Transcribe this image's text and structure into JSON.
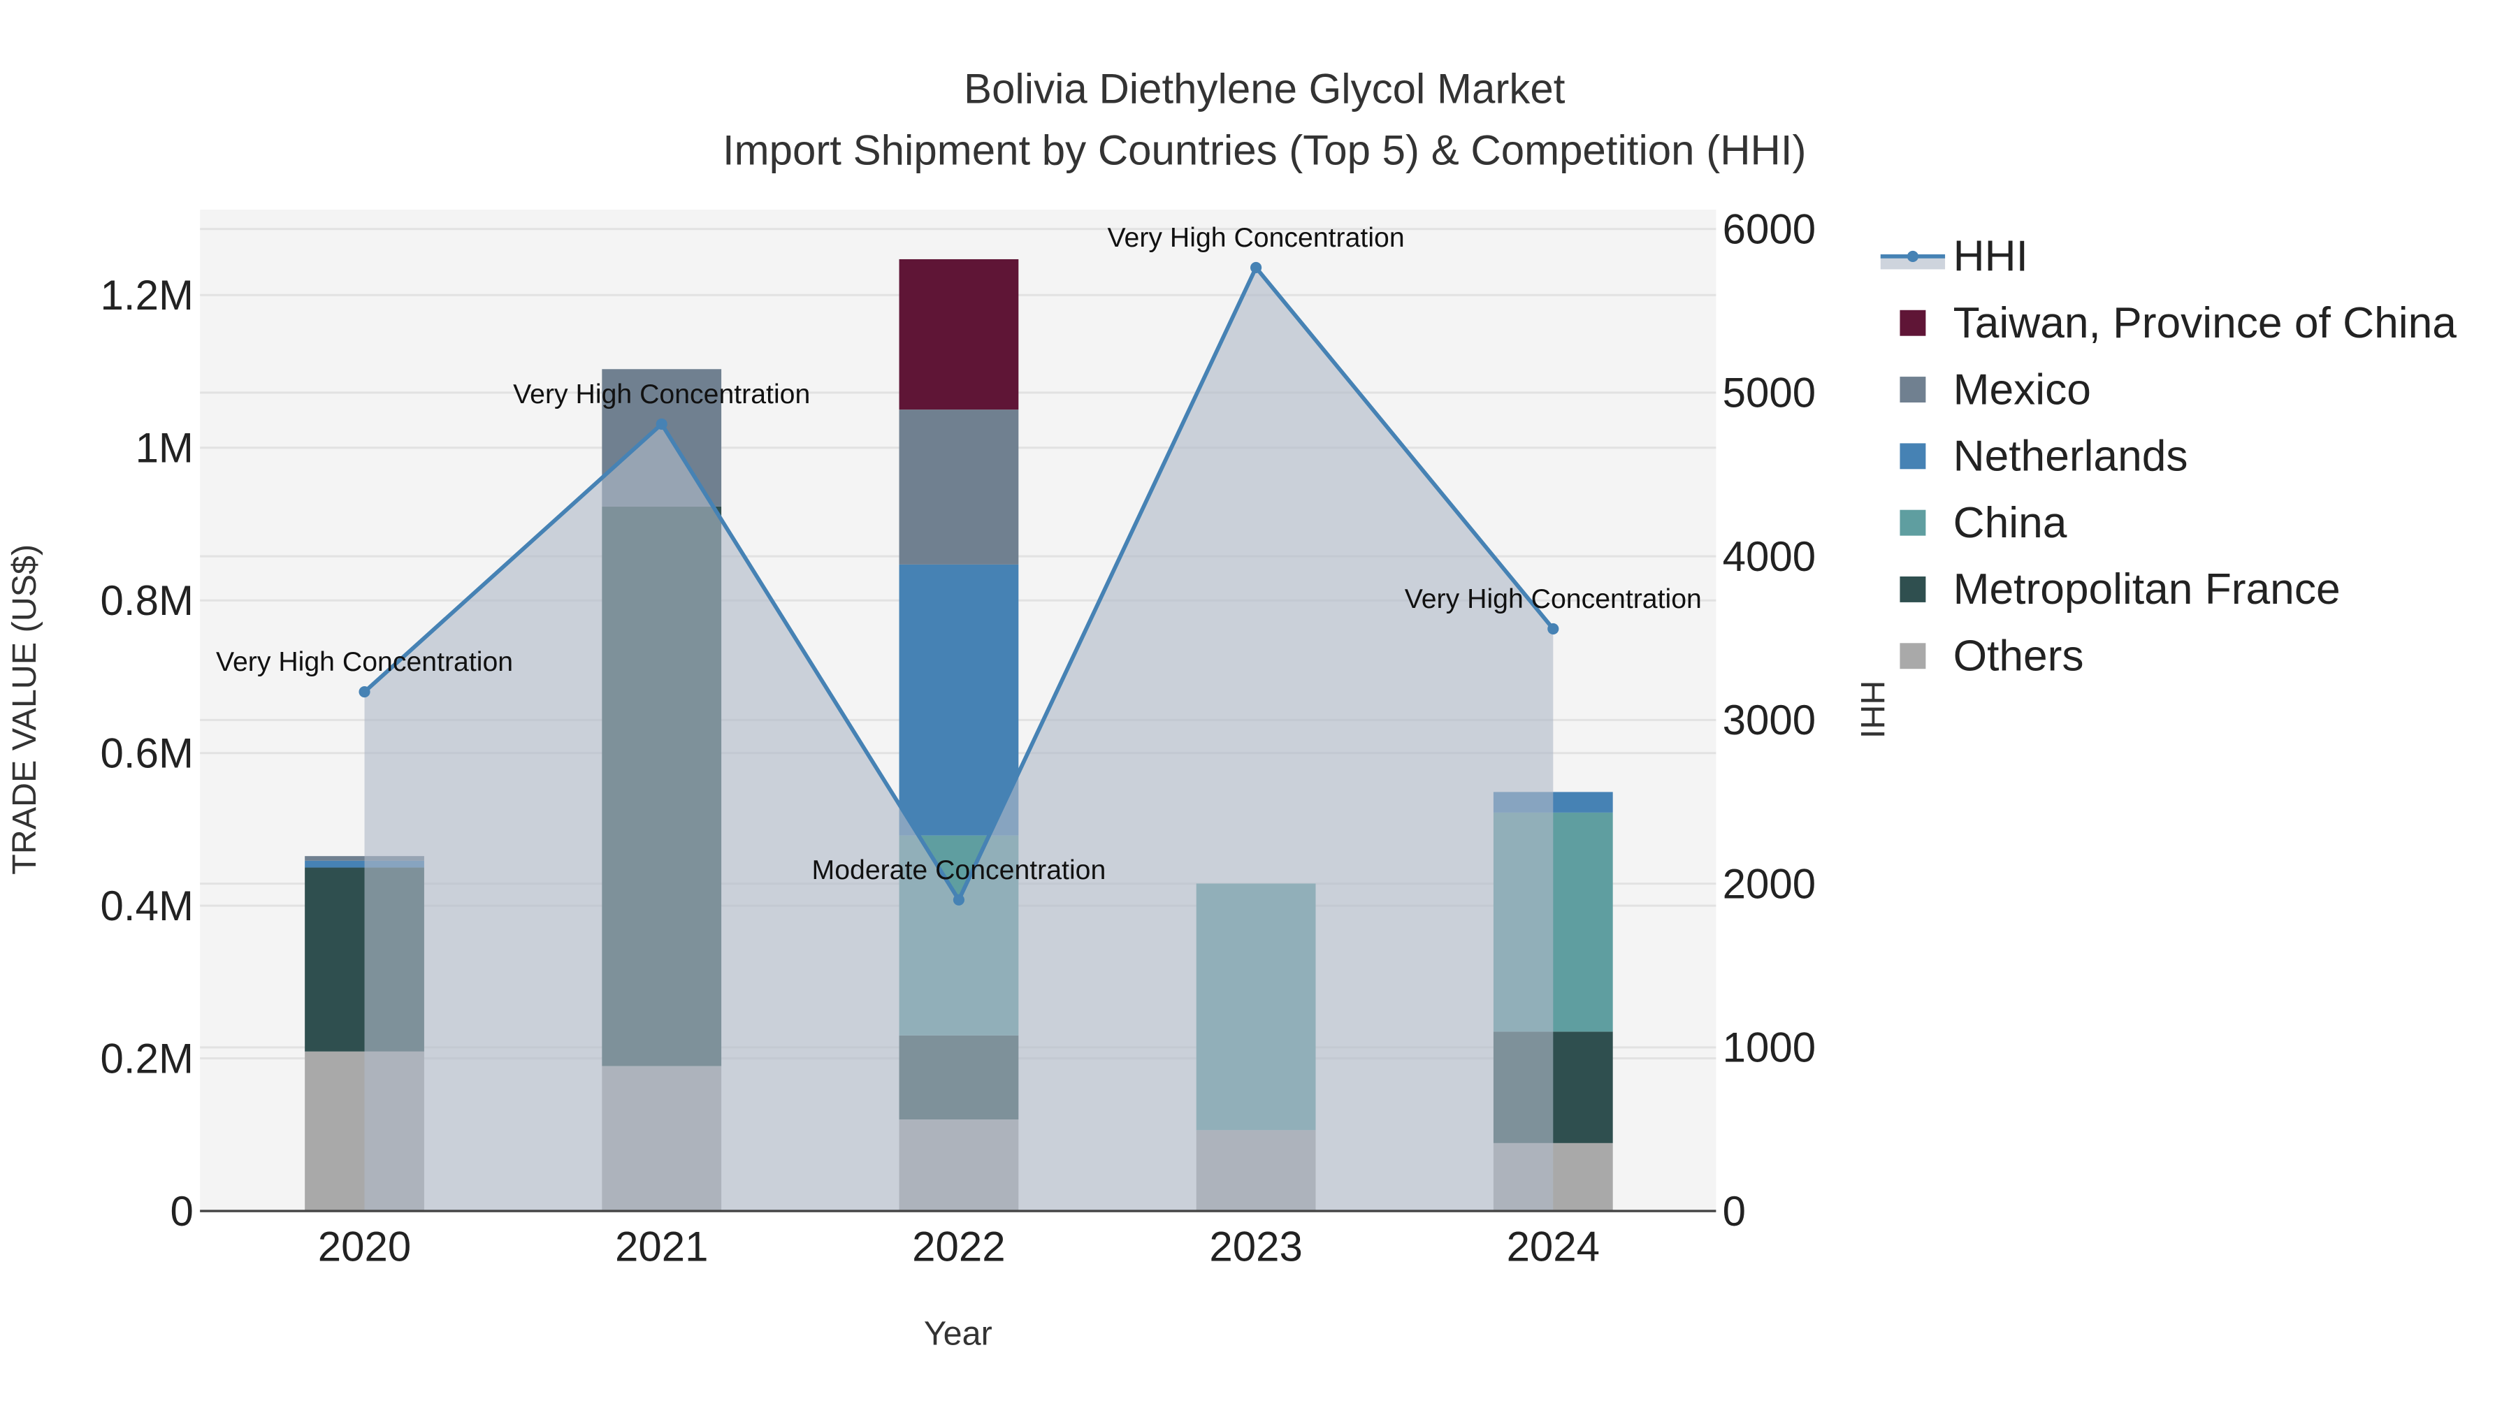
{
  "chart_data": {
    "type": "bar",
    "title": "Bolivia Diethylene Glycol Market",
    "subtitle": "Import Shipment by Countries (Top 5) & Competition (HHI)",
    "xlabel": "Year",
    "ylabel": "TRADE VALUE (US$)",
    "y2label": "HHI",
    "categories": [
      "2020",
      "2021",
      "2022",
      "2023",
      "2024"
    ],
    "ylim": [
      0,
      1300000
    ],
    "y2lim": [
      0,
      6120
    ],
    "yticks": [
      {
        "v": 0,
        "label": "0"
      },
      {
        "v": 200000,
        "label": "0.2M"
      },
      {
        "v": 400000,
        "label": "0.4M"
      },
      {
        "v": 600000,
        "label": "0.6M"
      },
      {
        "v": 800000,
        "label": "0.8M"
      },
      {
        "v": 1000000,
        "label": "1M"
      },
      {
        "v": 1200000,
        "label": "1.2M"
      }
    ],
    "y2ticks": [
      0,
      1000,
      2000,
      3000,
      4000,
      5000,
      6000
    ],
    "stacked": true,
    "series": [
      {
        "name": "Others",
        "color": "#a9a9a9",
        "values": [
          209000,
          190000,
          120000,
          106000,
          89000
        ]
      },
      {
        "name": "Metropolitan France",
        "color": "#2f4f4f",
        "values": [
          241000,
          733000,
          110000,
          0,
          146000
        ]
      },
      {
        "name": "China",
        "color": "#5f9ea0",
        "values": [
          0,
          0,
          262000,
          323000,
          287000
        ]
      },
      {
        "name": "Netherlands",
        "color": "#4682b4",
        "values": [
          9000,
          0,
          355000,
          0,
          27000
        ]
      },
      {
        "name": "Mexico",
        "color": "#708090",
        "values": [
          6000,
          180000,
          203000,
          0,
          0
        ]
      },
      {
        "name": "Taiwan, Province of China",
        "color": "#5f1536",
        "values": [
          0,
          0,
          197000,
          0,
          0
        ]
      }
    ],
    "hhi": {
      "name": "HHI",
      "color": "#4682b4",
      "values": [
        3172,
        4808,
        1901,
        5764,
        3557
      ],
      "annotations": [
        "Very High Concentration",
        "Very High Concentration",
        "Moderate Concentration",
        "Very High Concentration",
        "Very High Concentration"
      ]
    },
    "legend_order": [
      "HHI",
      "Taiwan, Province of China",
      "Mexico",
      "Netherlands",
      "China",
      "Metropolitan France",
      "Others"
    ],
    "legend_position": "right",
    "grid": true
  }
}
